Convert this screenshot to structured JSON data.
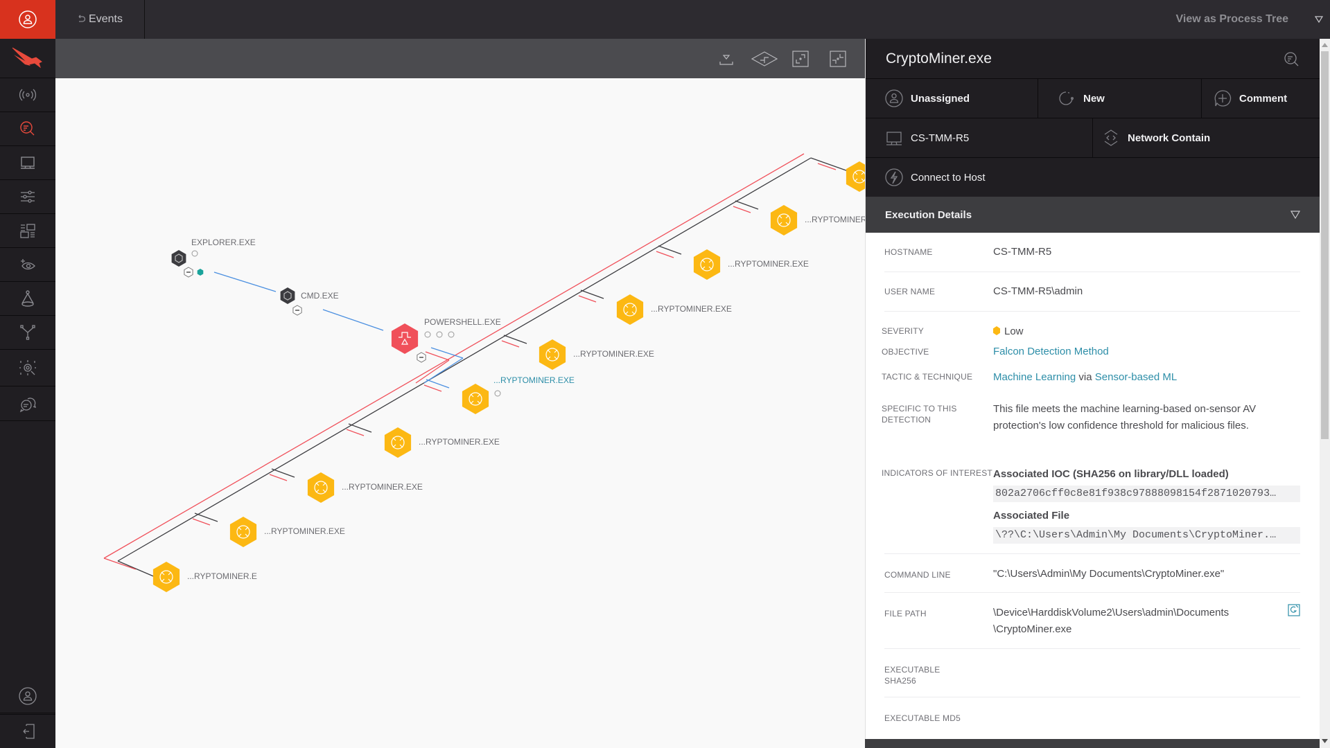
{
  "sidebar": {
    "items": [
      {
        "name": "activity",
        "icon": "signal-broadcast-icon"
      },
      {
        "name": "investigate",
        "icon": "search-investigate-icon",
        "active": true
      },
      {
        "name": "hosts",
        "icon": "monitor-icon"
      },
      {
        "name": "configuration",
        "icon": "sliders-icon"
      },
      {
        "name": "dashboards",
        "icon": "dashboard-layout-icon"
      },
      {
        "name": "discover",
        "icon": "eye-sparkle-icon"
      },
      {
        "name": "intelligence",
        "icon": "flask-icon"
      },
      {
        "name": "connections",
        "icon": "network-nodes-icon"
      },
      {
        "name": "spotlight",
        "icon": "target-icon"
      },
      {
        "name": "support",
        "icon": "chat-bubbles-icon"
      }
    ],
    "bottom": [
      {
        "name": "account",
        "icon": "user-icon"
      },
      {
        "name": "logout",
        "icon": "logout-icon"
      }
    ]
  },
  "topbar": {
    "back_label": "Events",
    "view_select": "View as Process Tree"
  },
  "toolbar": {
    "buttons": [
      "download-icon",
      "layout-diamond-icon",
      "expand-icon",
      "collapse-icon"
    ]
  },
  "graph": {
    "colors": {
      "cryptominer": "#fcb813",
      "powershell": "#f0505a",
      "system": "#3c3c40",
      "edge_blue": "#4a8fe0",
      "edge_red": "#f0505a",
      "edge_dark": "#3c3c40",
      "teal": "#1aa39b"
    },
    "nodes": [
      {
        "id": "explorer",
        "label": "EXPLORER.EXE",
        "type": "system"
      },
      {
        "id": "cmd",
        "label": "CMD.EXE",
        "type": "system"
      },
      {
        "id": "powershell",
        "label": "POWERSHELL.EXE",
        "type": "powershell"
      },
      {
        "id": "cm1",
        "label": "...RYPTOMINER.EXE",
        "type": "cryptominer"
      },
      {
        "id": "cm2",
        "label": "...RYPTOMINER.EXE",
        "type": "cryptominer"
      },
      {
        "id": "cm3",
        "label": "...RYPTOMINER.EXE",
        "type": "cryptominer"
      },
      {
        "id": "cm4",
        "label": "...RYPTOMINER.EXE",
        "type": "cryptominer"
      },
      {
        "id": "cm5",
        "label": "...RYPTOMINER.EXE",
        "type": "cryptominer",
        "selected": true
      },
      {
        "id": "cm6",
        "label": "...RYPTOMINER.EXE",
        "type": "cryptominer"
      },
      {
        "id": "cm7",
        "label": "...RYPTOMINER.EXE",
        "type": "cryptominer"
      },
      {
        "id": "cm8",
        "label": "...RYPTOMINER.EXE",
        "type": "cryptominer"
      },
      {
        "id": "cm9",
        "label": "...RYPTOMINER.E",
        "type": "cryptominer"
      },
      {
        "id": "cm10",
        "label": "",
        "type": "cryptominer"
      }
    ]
  },
  "panel": {
    "title": "CryptoMiner.exe",
    "assign_label": "Unassigned",
    "status_label": "New",
    "comment_label": "Comment",
    "host_label": "CS-TMM-R5",
    "contain_label": "Network Contain",
    "connect_label": "Connect to Host",
    "section_title": "Execution Details",
    "details": {
      "hostname_label": "HOSTNAME",
      "hostname": "CS-TMM-R5",
      "username_label": "USER NAME",
      "username": "CS-TMM-R5\\admin",
      "severity_label": "SEVERITY",
      "severity": "Low",
      "severity_color": "#fcb813",
      "objective_label": "OBJECTIVE",
      "objective": "Falcon Detection Method",
      "tactic_label": "TACTIC & TECHNIQUE",
      "tactic": "Machine Learning",
      "tactic_via": "via",
      "technique": "Sensor-based ML",
      "specific_label": "SPECIFIC TO THIS DETECTION",
      "specific": "This file meets the machine learning-based on-sensor AV protection's low confidence threshold for malicious files.",
      "indicators_label": "INDICATORS OF INTEREST",
      "ioc_title": "Associated IOC (SHA256 on library/DLL loaded)",
      "ioc_value": "802a2706cff0c8e81f938c97888098154f2871020793…",
      "file_title": "Associated File",
      "file_value": "\\??\\C:\\Users\\Admin\\My Documents\\CryptoMiner.…",
      "cmdline_label": "COMMAND LINE",
      "cmdline": "\"C:\\Users\\Admin\\My Documents\\CryptoMiner.exe\"",
      "filepath_label": "FILE PATH",
      "filepath_line1": "\\Device\\HarddiskVolume2\\Users\\admin\\Documents",
      "filepath_line2": "\\CryptoMiner.exe",
      "sha256_label": "EXECUTABLE SHA256",
      "md5_label": "EXECUTABLE MD5"
    }
  }
}
